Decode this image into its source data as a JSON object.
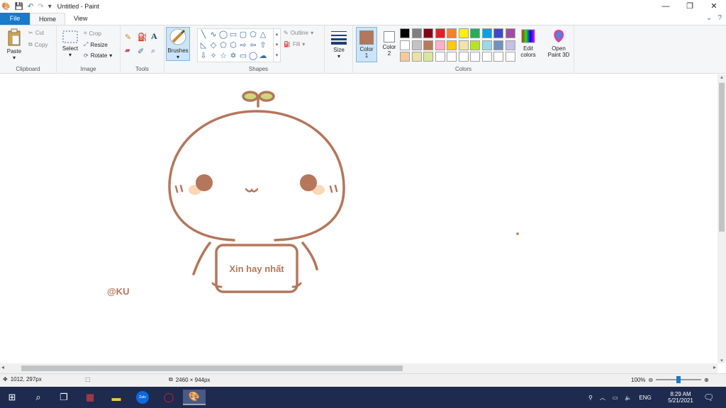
{
  "window": {
    "title": "Untitled - Paint"
  },
  "tabs": {
    "file": "File",
    "home": "Home",
    "view": "View"
  },
  "clipboard": {
    "paste": "Paste",
    "cut": "Cut",
    "copy": "Copy",
    "label": "Clipboard"
  },
  "image": {
    "select": "Select",
    "crop": "Crop",
    "resize": "Resize",
    "rotate": "Rotate",
    "label": "Image"
  },
  "tools": {
    "label": "Tools"
  },
  "brushes": {
    "label": "Brushes"
  },
  "shapes": {
    "outline": "Outline",
    "fill": "Fill",
    "label": "Shapes"
  },
  "size": {
    "label": "Size"
  },
  "colors": {
    "color1_label": "Color\n1",
    "color1_l1": "Color",
    "color1_l2": "1",
    "color2_l1": "Color",
    "color2_l2": "2",
    "edit_l1": "Edit",
    "edit_l2": "colors",
    "label": "Colors",
    "color1": "#b5765a",
    "color2": "#ffffff",
    "row1": [
      "#000000",
      "#7f7f7f",
      "#880015",
      "#ed1c24",
      "#ff7f27",
      "#fff200",
      "#22b14c",
      "#00a2e8",
      "#3f48cc",
      "#a349a4"
    ],
    "row2": [
      "#ffffff",
      "#c3c3c3",
      "#b97a57",
      "#ffaec9",
      "#ffc90e",
      "#efe4b0",
      "#b5e61d",
      "#99d9ea",
      "#7092be",
      "#c8bfe7"
    ],
    "row3": [
      "#f5c99a",
      "#e8e2a8",
      "#d8e89a",
      "#ffffff",
      "#ffffff",
      "#ffffff",
      "#ffffff",
      "#ffffff",
      "#ffffff",
      "#ffffff"
    ]
  },
  "paint3d": {
    "l1": "Open",
    "l2": "Paint 3D"
  },
  "drawing": {
    "sign_text": "Xin hay nhất",
    "signature": "@KU",
    "stroke": "#b5765a",
    "leaf": "#c8d97a",
    "blush": "#fbd7b5"
  },
  "status": {
    "cursor": "1012, 297px",
    "dimensions": "2460 × 944px",
    "zoom": "100%"
  },
  "taskbar": {
    "time": "8:29 AM",
    "date": "5/21/2021",
    "lang": "ENG",
    "zalo": "Zalo"
  }
}
